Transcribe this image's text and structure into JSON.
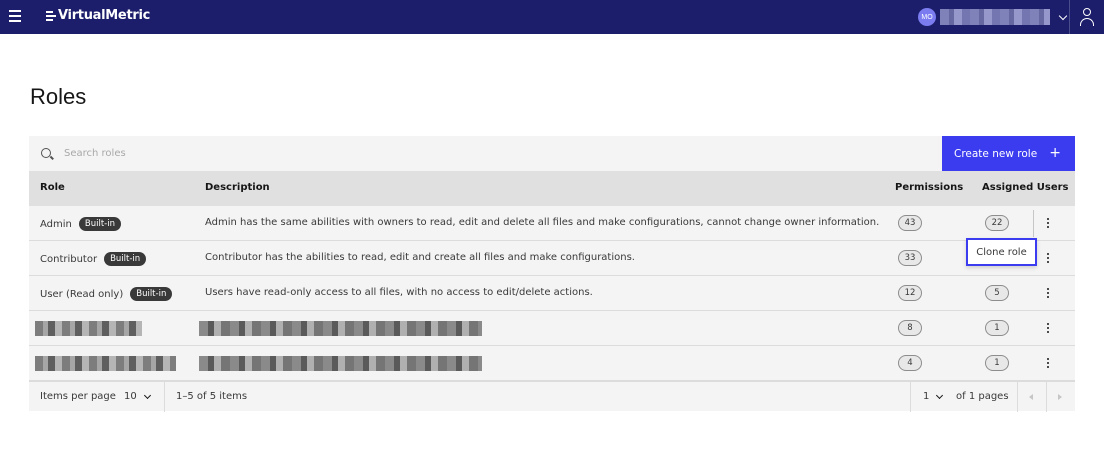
{
  "header": {
    "brand": "VirtualMetric",
    "user_initials": "MO"
  },
  "page": {
    "title": "Roles"
  },
  "toolbar": {
    "search_placeholder": "Search roles",
    "create_label": "Create new role",
    "create_icon": "+"
  },
  "table": {
    "headers": {
      "role": "Role",
      "description": "Description",
      "permissions": "Permissions",
      "assigned_users": "Assigned Users"
    },
    "builtin_label": "Built-in",
    "rows": [
      {
        "role": "Admin",
        "description": "Admin has the same abilities with owners to read, edit and delete all files and make configurations, cannot change owner information.",
        "permissions": "43",
        "users": "22"
      },
      {
        "role": "Contributor",
        "description": "Contributor has the abilities to read, edit and create all files and make configurations.",
        "permissions": "33",
        "users": ""
      },
      {
        "role": "User (Read only)",
        "description": "Users have read-only access to all files, with no access to edit/delete actions.",
        "permissions": "12",
        "users": "5"
      },
      {
        "role": "",
        "description": "",
        "permissions": "8",
        "users": "1"
      },
      {
        "role": "",
        "description": "",
        "permissions": "4",
        "users": "1"
      }
    ]
  },
  "popover": {
    "clone_label": "Clone role"
  },
  "pagination": {
    "items_per_page_label": "Items per page",
    "items_per_page_value": "10",
    "range_text": "1–5 of 5 items",
    "current_page": "1",
    "of_pages_text": "of 1 pages"
  },
  "colors": {
    "topbar": "#1c1d6b",
    "primary_button": "#3b3bf0",
    "row_background": "#f4f4f4",
    "header_background": "#e0e0e0"
  }
}
